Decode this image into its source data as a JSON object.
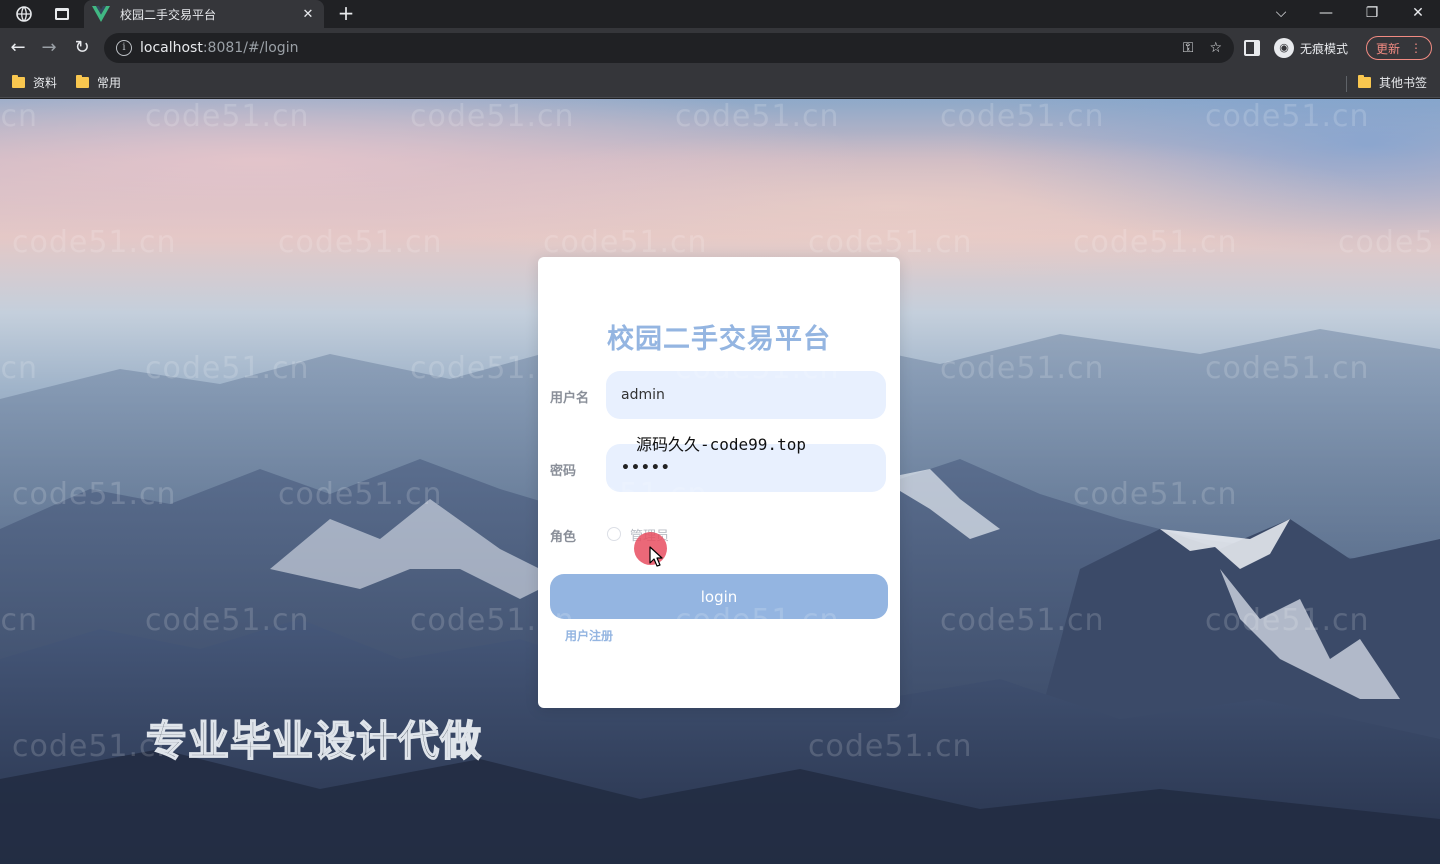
{
  "browser": {
    "tab_title": "校园二手交易平台",
    "new_tab": "+",
    "tab_close": "✕",
    "url_host": "localhost",
    "url_rest": ":8081/#/login",
    "incognito_label": "无痕模式",
    "update_label": "更新",
    "bookmarks": [
      {
        "label": "资料"
      },
      {
        "label": "常用"
      }
    ],
    "other_bookmarks": "其他书签",
    "colors": {
      "chrome_bg": "#202124",
      "toolbar_bg": "#35363a",
      "update_accent": "#f28b82",
      "folder": "#f9c74f"
    }
  },
  "page": {
    "watermark": "code51.cn",
    "login": {
      "title": "校园二手交易平台",
      "username_label": "用户名",
      "username_value": "admin",
      "password_label": "密码",
      "password_value": "•••••",
      "role_label": "角色",
      "role_option": "管理员",
      "login_button": "login",
      "register_link": "用户注册"
    },
    "overlay_text": "源码久久-code99.top",
    "promo_text": "专业毕业设计代做",
    "colors": {
      "accent": "#94b5e1",
      "input_bg": "#e8f0fe",
      "click_marker": "#e84e60"
    }
  }
}
